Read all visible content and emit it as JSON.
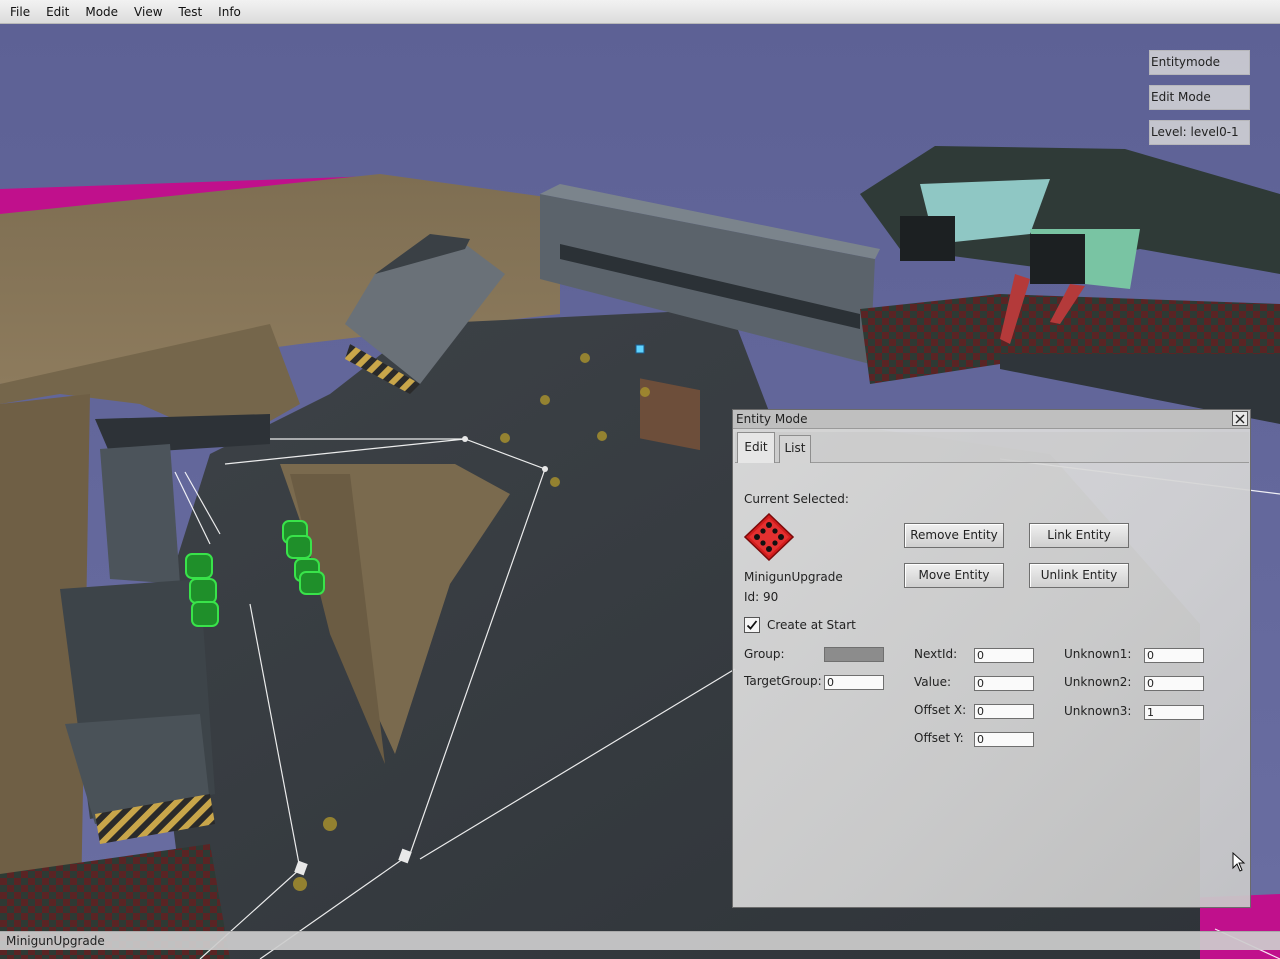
{
  "menu": [
    "File",
    "Edit",
    "Mode",
    "View",
    "Test",
    "Info"
  ],
  "hud": {
    "mode": "Entitymode",
    "edit_mode": "Edit Mode",
    "level": "Level: level0-1"
  },
  "dialog": {
    "title": "Entity Mode",
    "tabs": [
      "Edit",
      "List"
    ],
    "current_selected_label": "Current Selected:",
    "entity_icon": "red-dice-icon",
    "entity_name": "MinigunUpgrade",
    "entity_id": "Id: 90",
    "buttons": {
      "remove": "Remove Entity",
      "link": "Link Entity",
      "move": "Move Entity",
      "unlink": "Unlink Entity"
    },
    "create_at_start": {
      "label": "Create at Start",
      "checked": true
    },
    "fields": {
      "group_label": "Group:",
      "group_value": "",
      "targetgroup_label": "TargetGroup:",
      "targetgroup_value": "0",
      "nextid_label": "NextId:",
      "nextid_value": "0",
      "value_label": "Value:",
      "value_value": "0",
      "offsetx_label": "Offset X:",
      "offsetx_value": "0",
      "offsety_label": "Offset Y:",
      "offsety_value": "0",
      "unknown1_label": "Unknown1:",
      "unknown1_value": "0",
      "unknown2_label": "Unknown2:",
      "unknown2_value": "0",
      "unknown3_label": "Unknown3:",
      "unknown3_value": "1"
    }
  },
  "statusbar": {
    "text": "MinigunUpgrade"
  },
  "colors": {
    "sky": "#5f6495",
    "ground": "#7d6f55",
    "magenta": "#c0108c",
    "road": "#3a3f44",
    "accent_red": "#cc1f1f"
  }
}
